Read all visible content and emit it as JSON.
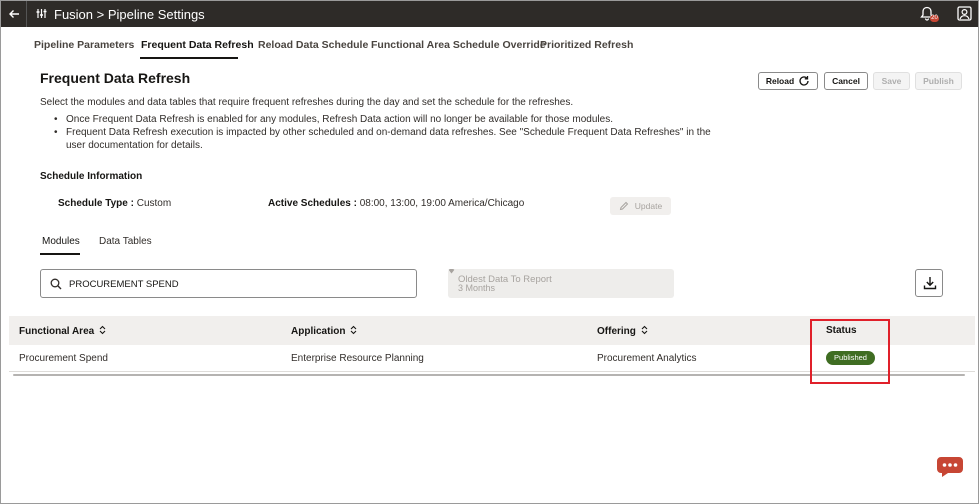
{
  "header": {
    "title": "Fusion > Pipeline Settings",
    "notification_count": "20"
  },
  "tabs": [
    {
      "label": "Pipeline Parameters"
    },
    {
      "label": "Frequent Data Refresh"
    },
    {
      "label": "Reload Data Schedule"
    },
    {
      "label": "Functional Area Schedule Override"
    },
    {
      "label": "Prioritized Refresh"
    }
  ],
  "page": {
    "title": "Frequent Data Refresh",
    "description": "Select the modules and data tables that require frequent refreshes during the day and set the schedule for the refreshes.",
    "bullets": [
      "Once Frequent Data Refresh is enabled for any modules, Refresh Data action will no longer be available for those modules.",
      "Frequent Data Refresh execution is impacted by other scheduled and on-demand data refreshes. See \"Schedule Frequent Data Refreshes\" in the user documentation for details."
    ]
  },
  "actions": {
    "reload": "Reload",
    "cancel": "Cancel",
    "save": "Save",
    "publish": "Publish"
  },
  "schedule": {
    "section_title": "Schedule Information",
    "type_label": "Schedule Type :",
    "type_value": "Custom",
    "active_label": "Active Schedules :",
    "active_value": "08:00, 13:00, 19:00 America/Chicago",
    "update_label": "Update"
  },
  "subtabs": [
    {
      "label": "Modules"
    },
    {
      "label": "Data Tables"
    }
  ],
  "search": {
    "value": "PROCUREMENT SPEND"
  },
  "filter": {
    "label": "Oldest Data To Report",
    "value": "3 Months"
  },
  "table": {
    "columns": [
      "Functional Area",
      "Application",
      "Offering",
      "Status"
    ],
    "rows": [
      [
        "Procurement Spend",
        "Enterprise Resource Planning",
        "Procurement Analytics",
        "Published"
      ]
    ]
  },
  "colors": {
    "topbar": "#2e2b28",
    "status_published": "#3f6d22",
    "highlight": "#e0202a",
    "chat": "#c74634"
  }
}
